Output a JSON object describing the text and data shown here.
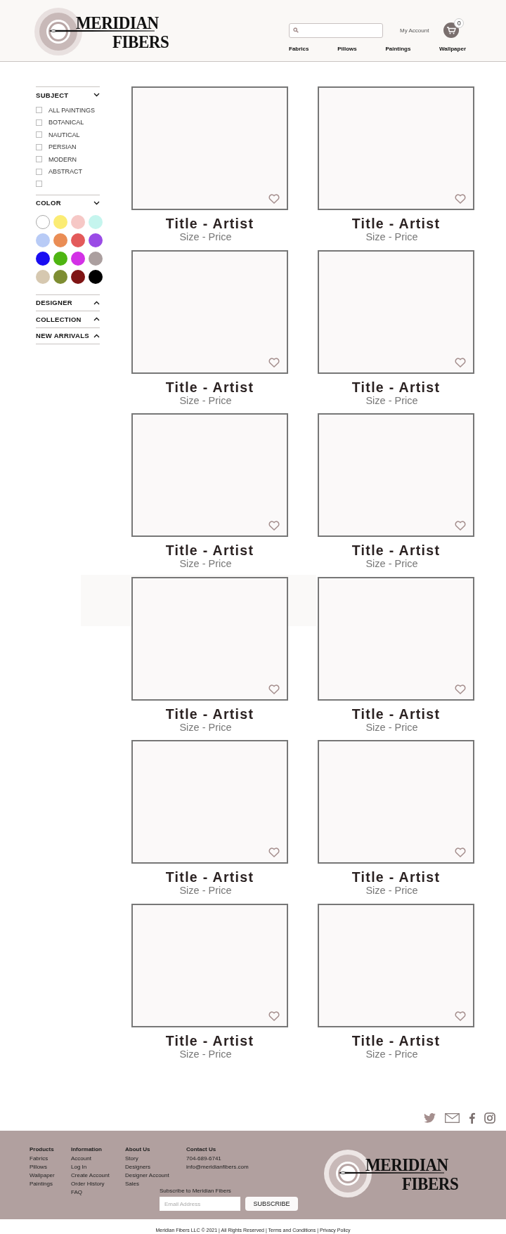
{
  "header": {
    "logo": {
      "line_1": "MERIDIAN",
      "line_2": "FIBERS"
    },
    "account_link": "My Account",
    "cart_count": "0",
    "nav": [
      "Fabrics",
      "Pillows",
      "Paintings",
      "Wallpaper"
    ]
  },
  "sidebar": {
    "sections": [
      {
        "kind": "checklist",
        "title": "SUBJECT",
        "expanded": true,
        "items": [
          {
            "label": "ALL PAINTINGS",
            "checked": false
          },
          {
            "label": "BOTANICAL",
            "checked": false
          },
          {
            "label": "NAUTICAL",
            "checked": false
          },
          {
            "label": "PERSIAN",
            "checked": false
          },
          {
            "label": "MODERN",
            "checked": false
          },
          {
            "label": "ABSTRACT",
            "checked": false
          },
          {
            "checked": false
          }
        ]
      },
      {
        "kind": "swatches",
        "title": "COLOR",
        "expanded": true,
        "items": [
          {
            "color": "#ffffff"
          },
          {
            "color": "#fbec74"
          },
          {
            "color": "#f6c8c6"
          },
          {
            "color": "#c5f5ee"
          },
          {
            "color": "#b8cbf6"
          },
          {
            "color": "#ea8d55"
          },
          {
            "color": "#e35a5a"
          },
          {
            "color": "#9a4be6"
          },
          {
            "color": "#1a0df2"
          },
          {
            "color": "#4eb511"
          },
          {
            "color": "#d331e6"
          },
          {
            "color": "#ab9f9f"
          },
          {
            "color": "#d6c8b0"
          },
          {
            "color": "#7e8d32"
          },
          {
            "color": "#7f1414"
          },
          {
            "color": "#000000"
          }
        ]
      },
      {
        "kind": "collapsed",
        "title": "DESIGNER",
        "expanded": false
      },
      {
        "kind": "collapsed",
        "title": "COLLECTION",
        "expanded": false
      },
      {
        "kind": "collapsed",
        "title": "NEW ARRIVALS",
        "expanded": false
      }
    ]
  },
  "products": [
    {
      "title": "Title - Artist",
      "subtitle": "Size - Price",
      "favorite": false
    },
    {
      "title": "Title - Artist",
      "subtitle": "Size - Price",
      "favorite": false
    },
    {
      "title": "Title - Artist",
      "subtitle": "Size - Price",
      "favorite": false
    },
    {
      "title": "Title - Artist",
      "subtitle": "Size - Price",
      "favorite": false
    },
    {
      "title": "Title - Artist",
      "subtitle": "Size - Price",
      "favorite": false
    },
    {
      "title": "Title - Artist",
      "subtitle": "Size - Price",
      "favorite": false
    },
    {
      "title": "Title - Artist",
      "subtitle": "Size - Price",
      "favorite": false
    },
    {
      "title": "Title - Artist",
      "subtitle": "Size - Price",
      "favorite": false
    },
    {
      "title": "Title - Artist",
      "subtitle": "Size - Price",
      "favorite": false
    },
    {
      "title": "Title - Artist",
      "subtitle": "Size - Price",
      "favorite": false
    },
    {
      "title": "Title - Artist",
      "subtitle": "Size - Price",
      "favorite": false
    },
    {
      "title": "Title - Artist",
      "subtitle": "Size - Price",
      "favorite": false
    }
  ],
  "footer": {
    "columns": [
      {
        "heading": "Products",
        "links": [
          "Fabrics",
          "Pillows",
          "Wallpaper",
          "Paintings"
        ]
      },
      {
        "heading": "Information",
        "links": [
          "Account",
          "Log In",
          "Create Account",
          "Order History",
          "FAQ"
        ]
      },
      {
        "heading": "About Us",
        "links": [
          "Story",
          "Designers",
          "Designer Account",
          "Sales"
        ]
      },
      {
        "heading": "Contact Us",
        "links": [
          "704-689-6741",
          "info@meridianfibers.com"
        ]
      }
    ],
    "subscribe": {
      "label": "Subscribe to Meridian Fibers",
      "placeholder": "Email Address",
      "button": "SUBSCRIBE"
    },
    "logo": {
      "line_1": "MERIDIAN",
      "line_2": "FIBERS"
    },
    "copyright": "Meridian Fibers LLC © 2021 | All Rights Reserved | Terms and Conditions | Privacy Policy"
  }
}
